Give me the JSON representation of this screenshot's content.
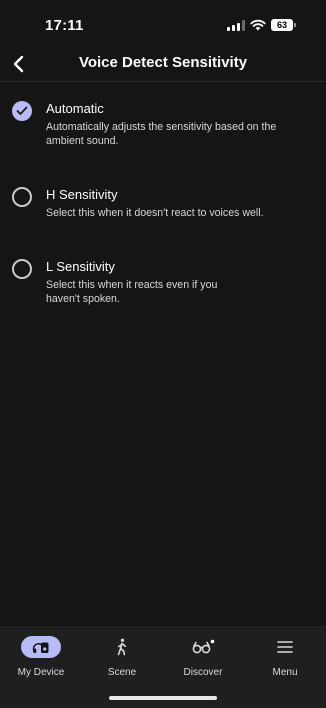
{
  "status_bar": {
    "time": "17:11",
    "battery": "63"
  },
  "header": {
    "title": "Voice Detect Sensitivity"
  },
  "options": [
    {
      "title": "Automatic",
      "description": "Automatically adjusts the sensitivity based on the ambient sound.",
      "selected": true
    },
    {
      "title": "H Sensitivity",
      "description": "Select this when it doesn't react to voices well.",
      "selected": false
    },
    {
      "title": "L Sensitivity",
      "description": "Select this when it reacts even if you haven't spoken.",
      "selected": false
    }
  ],
  "tabs": [
    {
      "label": "My Device",
      "icon": "device-icon",
      "active": true
    },
    {
      "label": "Scene",
      "icon": "walking-icon",
      "active": false
    },
    {
      "label": "Discover",
      "icon": "binoculars-icon",
      "active": false
    },
    {
      "label": "Menu",
      "icon": "menu-icon",
      "active": false
    }
  ],
  "colors": {
    "accent": "#b7bcf7",
    "background": "#151515",
    "tab_bar": "#1f1f1f"
  }
}
